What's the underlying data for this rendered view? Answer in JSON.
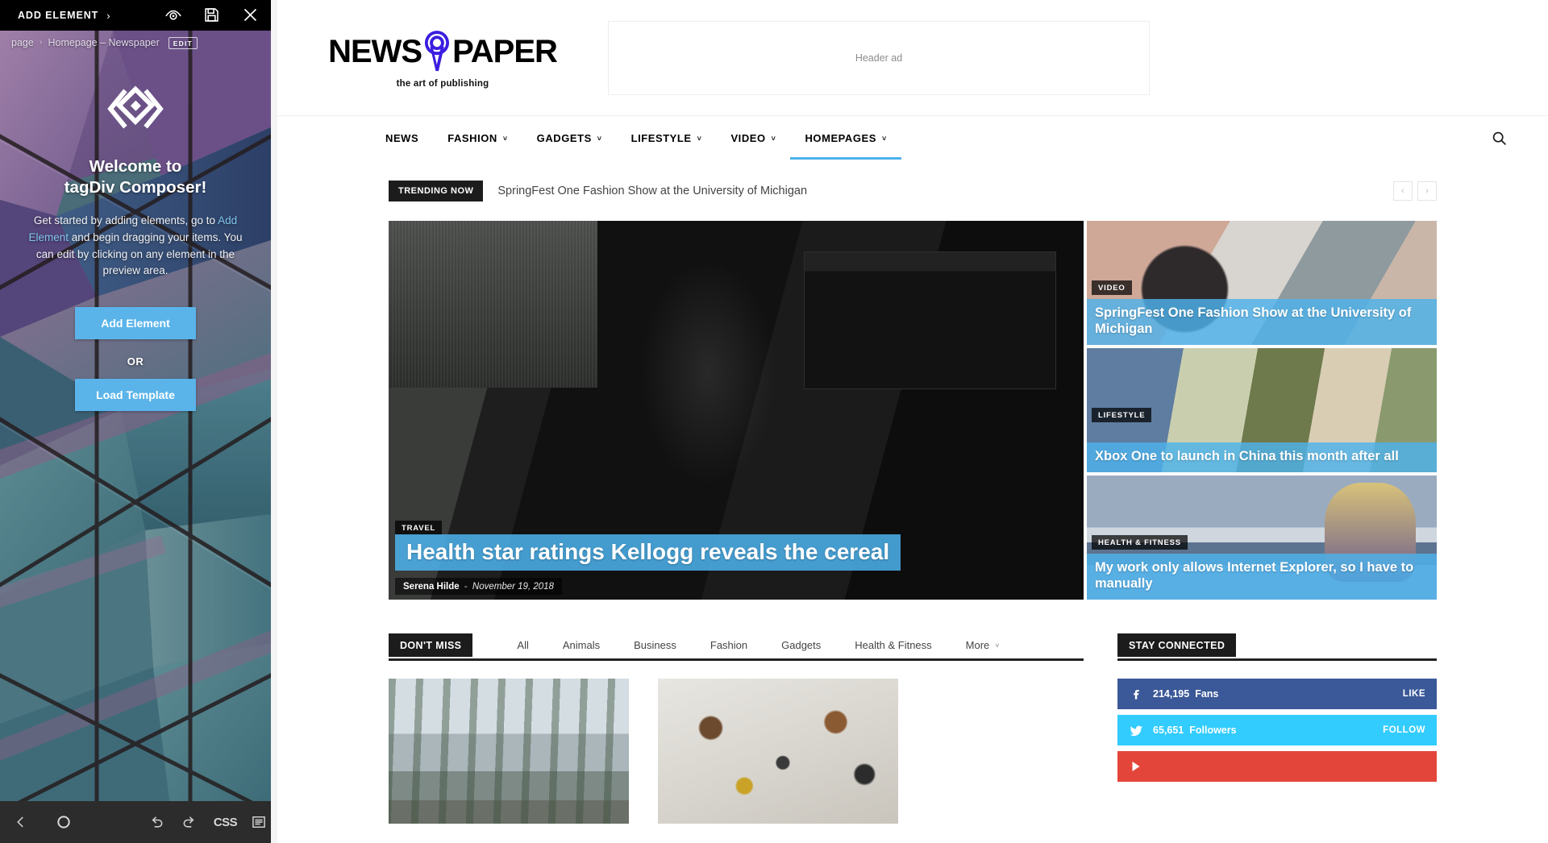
{
  "composer": {
    "topbar": {
      "add_element_label": "ADD ELEMENT",
      "chevron": "›",
      "icons": [
        "eye-preview-icon",
        "save-icon",
        "close-icon"
      ]
    },
    "breadcrumb": {
      "root": "page",
      "separator": "›",
      "current": "Homepage – Newspaper",
      "edit_label": "EDIT"
    },
    "welcome": {
      "title_line1": "Welcome to",
      "title_line2": "tagDiv Composer!",
      "body_before": "Get started by adding elements, go to ",
      "body_highlight": "Add Element",
      "body_after": " and begin dragging your items. You can edit by clicking on any element in the preview area.",
      "primary_button": "Add Element",
      "or_label": "OR",
      "secondary_button": "Load Template"
    },
    "bottombar": {
      "back": "back-icon",
      "record": "record-icon",
      "undo": "undo-icon",
      "redo": "redo-icon",
      "css": "CSS",
      "panel": "panel-toggle-icon"
    },
    "accent_blue": "#5ab4ea",
    "link_blue": "#7fc4ee"
  },
  "site": {
    "brand": {
      "word1": "NEWS",
      "nine": "9",
      "word2": "PAPER",
      "tagline": "the art of publishing",
      "nine_color": "#3a1ee0"
    },
    "header_ad": {
      "label": "Header ad"
    },
    "nav": {
      "items": [
        {
          "label": "NEWS",
          "has_caret": false,
          "active": false
        },
        {
          "label": "FASHION",
          "has_caret": true,
          "active": false
        },
        {
          "label": "GADGETS",
          "has_caret": true,
          "active": false
        },
        {
          "label": "LIFESTYLE",
          "has_caret": true,
          "active": false
        },
        {
          "label": "VIDEO",
          "has_caret": true,
          "active": false
        },
        {
          "label": "HOMEPAGES",
          "has_caret": true,
          "active": true
        }
      ],
      "caret": "˅",
      "search_icon": "search-icon",
      "active_underline_color": "#4db2ec"
    },
    "trending": {
      "badge": "TRENDING NOW",
      "headline": "SpringFest One Fashion Show at the University of Michigan",
      "prev": "‹",
      "next": "›"
    },
    "featured": {
      "main": {
        "category": "TRAVEL",
        "title": "Health star ratings Kellogg reveals the cereal",
        "author": "Serena Hilde",
        "separator": "-",
        "date": "November 19, 2018",
        "image": "guitarist-sitting-on-marshall-amplifier-stack"
      },
      "side": [
        {
          "category": "VIDEO",
          "title": "SpringFest One Fashion Show at the University of Michigan",
          "image": "tattooed-woman-holding-phone-and-cup"
        },
        {
          "category": "LIFESTYLE",
          "title": "Xbox One to launch in China this month after all",
          "image": "couple-outdoors-near-tree"
        },
        {
          "category": "HEALTH & FITNESS",
          "title": "My work only allows Internet Explorer, so I have to manually",
          "image": "person-with-hat-on-train-platform"
        }
      ]
    },
    "dont_miss": {
      "badge": "DON'T MISS",
      "tabs": [
        "All",
        "Animals",
        "Business",
        "Fashion",
        "Gadgets",
        "Health & Fitness"
      ],
      "more_label": "More",
      "caret": "˅",
      "posts": [
        {
          "image": "snowy-road-lined-with-trees"
        },
        {
          "image": "vintage-objects-flat-lay-on-white-wall"
        }
      ]
    },
    "stay_connected": {
      "badge": "STAY CONNECTED",
      "socials": [
        {
          "network": "facebook-icon",
          "glyph": "f",
          "count": "214,195",
          "unit": "Fans",
          "action": "LIKE",
          "color": "#3b5998"
        },
        {
          "network": "twitter-icon",
          "glyph": "🐦",
          "count": "65,651",
          "unit": "Followers",
          "action": "FOLLOW",
          "color": "#32ccfe"
        },
        {
          "network": "youtube-icon",
          "glyph": "▶",
          "count": "",
          "unit": "",
          "action": "",
          "color": "#e4453a"
        }
      ]
    }
  }
}
